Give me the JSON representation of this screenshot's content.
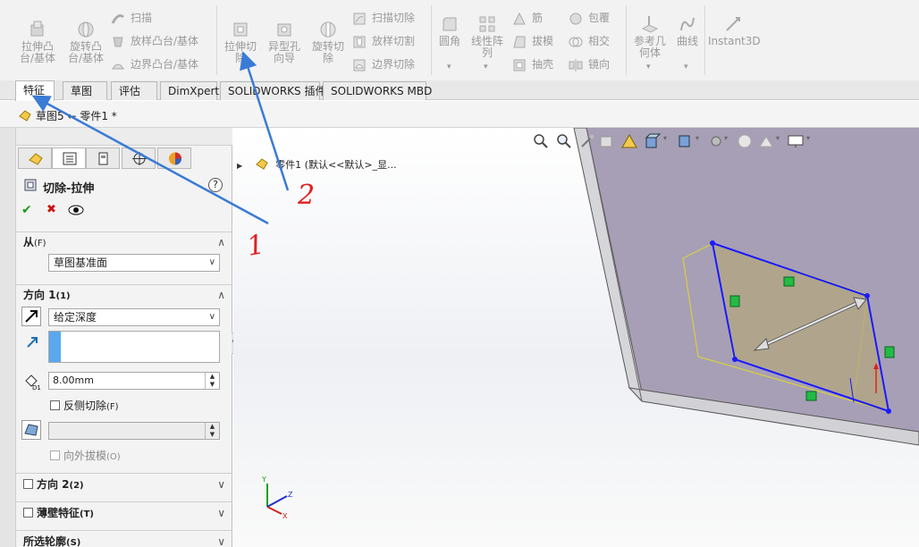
{
  "ribbon": {
    "extrude_boss": "拉伸凸台/基体",
    "revolve_boss": "旋转凸台/基体",
    "sweep": "扫描",
    "loft_boss": "放样凸台/基体",
    "boundary_boss": "边界凸台/基体",
    "extrude_cut": "拉伸切除",
    "hole_wizard": "异型孔向导",
    "revolve_cut": "旋转切除",
    "swept_cut": "扫描切除",
    "loft_cut": "放样切割",
    "boundary_cut": "边界切除",
    "fillet": "圆角",
    "linear_pattern": "线性阵列",
    "rib": "筋",
    "draft": "拔模",
    "shell": "抽壳",
    "wrap": "包覆",
    "intersect": "相交",
    "mirror": "镜向",
    "ref_geometry": "参考几何体",
    "curves": "曲线",
    "instant3d": "Instant3D"
  },
  "tabs": [
    "特征",
    "草图",
    "评估",
    "DimXpert",
    "SOLIDWORKS 插件",
    "SOLIDWORKS MBD"
  ],
  "breadcrumb": "草图5 ← 零件1 *",
  "feature_tree": {
    "root_label": "零件1 (默认<<默认>_显..."
  },
  "pm": {
    "title": "切除-拉伸",
    "help": "?",
    "ok": "✔",
    "cancel": "✖",
    "from_label": "从",
    "from_key": "(F)",
    "from_value": "草图基准面",
    "dir1_label": "方向 1",
    "dir1_key": "(1)",
    "end_condition": "给定深度",
    "depth": "8.00mm",
    "depth_symbol": "D1",
    "flip_side": "反侧切除",
    "flip_side_key": "(F)",
    "draft_outward": "向外拔模",
    "draft_outward_key": "(O)",
    "dir2_label": "方向 2",
    "dir2_key": "(2)",
    "thin_label": "薄壁特征",
    "thin_key": "(T)",
    "contours_label": "所选轮廓",
    "contours_key": "(S)"
  },
  "annotations": {
    "label1": "1",
    "label2": "2",
    "arrow_color": "#3a7bd5",
    "label_color": "#e02020"
  },
  "colors": {
    "sketch": "#1a1aff",
    "plate_top": "#a59db3",
    "plate_side": "#cfcfd4",
    "sketch_fill": "#b3a77f",
    "relation": "#22bb44"
  }
}
